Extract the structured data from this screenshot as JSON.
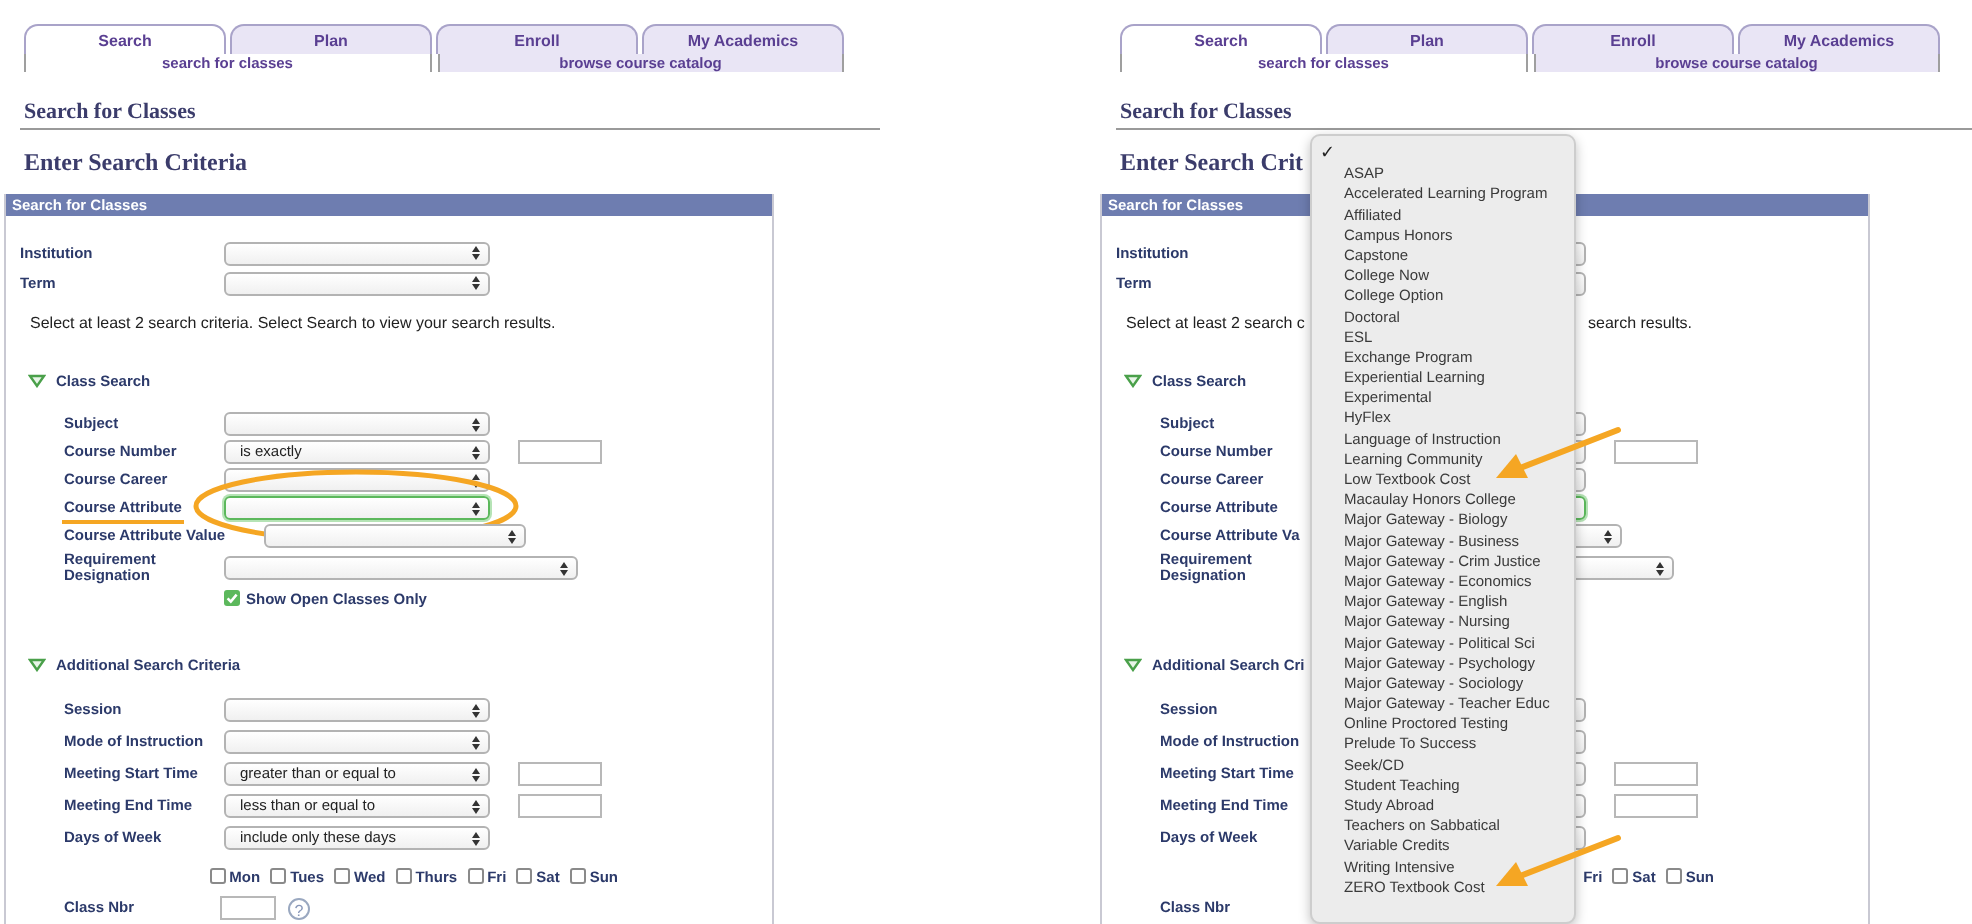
{
  "panels": [
    {
      "tabs": [
        {
          "label": "Search",
          "selected": true
        },
        {
          "label": "Plan",
          "selected": false
        },
        {
          "label": "Enroll",
          "selected": false
        },
        {
          "label": "My Academics",
          "selected": false
        }
      ],
      "subtabs": [
        {
          "label": "search for classes",
          "selected": true
        },
        {
          "label": "browse course catalog",
          "selected": false
        }
      ],
      "title": "Search for Classes",
      "subtitle": "Enter Search Criteria",
      "box_title": "Search for Classes",
      "top_fields": [
        {
          "label": "Institution",
          "kind": "select"
        },
        {
          "label": "Term",
          "kind": "select"
        }
      ],
      "note_parts": [
        "Select at least 2 search criteria. Select Search to view your search results."
      ],
      "sections": [
        {
          "title": "Class Search",
          "expanded": true,
          "fields": [
            {
              "label": "Subject",
              "kind": "select"
            },
            {
              "label": "Course Number",
              "kind": "select_input",
              "value": "is exactly"
            },
            {
              "label": "Course Career",
              "kind": "select"
            },
            {
              "label": "Course Attribute",
              "kind": "select",
              "focused": true,
              "circled": true,
              "underlined": true
            },
            {
              "label": "Course Attribute Value",
              "kind": "select_offset"
            },
            {
              "label": "Requirement Designation",
              "kind": "select_wide"
            },
            {
              "label": "Show Open Classes Only",
              "kind": "checkbox",
              "checked": true
            }
          ]
        },
        {
          "title": "Additional Search Criteria",
          "expanded": true,
          "fields": [
            {
              "label": "Session",
              "kind": "select"
            },
            {
              "label": "Mode of Instruction",
              "kind": "select"
            },
            {
              "label": "Meeting Start Time",
              "kind": "select_input",
              "value": "greater than or equal to"
            },
            {
              "label": "Meeting End Time",
              "kind": "select_input",
              "value": "less than or equal to"
            },
            {
              "label": "Days of Week",
              "kind": "select",
              "value": "include only these days"
            },
            {
              "kind": "days",
              "days": [
                {
                  "label": "Mon",
                  "checked": false
                },
                {
                  "label": "Tues",
                  "checked": false
                },
                {
                  "label": "Wed",
                  "checked": false
                },
                {
                  "label": "Thurs",
                  "checked": false
                },
                {
                  "label": "Fri",
                  "checked": false
                },
                {
                  "label": "Sat",
                  "checked": false
                },
                {
                  "label": "Sun",
                  "checked": false
                }
              ]
            },
            {
              "label": "Class Nbr",
              "kind": "input_help",
              "help": "?"
            }
          ]
        }
      ]
    },
    {
      "tabs": [
        {
          "label": "Search",
          "selected": true
        },
        {
          "label": "Plan",
          "selected": false
        },
        {
          "label": "Enroll",
          "selected": false
        },
        {
          "label": "My Academics",
          "selected": false
        }
      ],
      "subtabs": [
        {
          "label": "search for classes",
          "selected": true
        },
        {
          "label": "browse course catalog",
          "selected": false
        }
      ],
      "title": "Search for Classes",
      "subtitle": "Enter Search Crit",
      "box_title": "Search for Classes",
      "top_fields": [
        {
          "label": "Institution",
          "kind": "select"
        },
        {
          "label": "Term",
          "kind": "select"
        }
      ],
      "note_parts": [
        "Select at least 2 search c",
        "search results."
      ],
      "sections": [
        {
          "title": "Class Search",
          "expanded": true,
          "fields": [
            {
              "label": "Subject",
              "kind": "select"
            },
            {
              "label": "Course Number",
              "kind": "select_input"
            },
            {
              "label": "Course Career",
              "kind": "select"
            },
            {
              "label": "Course Attribute",
              "kind": "select",
              "focused": true
            },
            {
              "label": "Course Attribute Va",
              "kind": "select_offset"
            },
            {
              "label": "Requirement Designation",
              "kind": "select_wide"
            }
          ]
        },
        {
          "title": "Additional Search Cri",
          "expanded": true,
          "fields": [
            {
              "label": "Session",
              "kind": "select"
            },
            {
              "label": "Mode of Instruction",
              "kind": "select"
            },
            {
              "label": "Meeting Start Time",
              "kind": "select_input"
            },
            {
              "label": "Meeting End Time",
              "kind": "select_input"
            },
            {
              "label": "Days of Week",
              "kind": "select"
            },
            {
              "kind": "days",
              "days": [
                {
                  "label": "Fri"
                },
                {
                  "label": "Sat",
                  "checked": false
                },
                {
                  "label": "Sun",
                  "checked": false
                }
              ]
            },
            {
              "label": "Class Nbr",
              "kind": "label"
            }
          ]
        }
      ],
      "menu": {
        "checkmark": "✓",
        "options": [
          {
            "selected": true
          },
          {
            "label": "ASAP",
            "selected": false
          },
          {
            "label": "Accelerated Learning Program",
            "selected": false
          },
          {
            "label": "Affiliated",
            "selected": false
          },
          {
            "label": "Campus Honors",
            "selected": false
          },
          {
            "label": "Capstone",
            "selected": false
          },
          {
            "label": "College Now",
            "selected": false
          },
          {
            "label": "College Option",
            "selected": false
          },
          {
            "label": "Doctoral",
            "selected": false
          },
          {
            "label": "ESL",
            "selected": false
          },
          {
            "label": "Exchange Program",
            "selected": false
          },
          {
            "label": "Experiential Learning",
            "selected": false
          },
          {
            "label": "Experimental",
            "selected": false
          },
          {
            "label": "HyFlex",
            "selected": false
          },
          {
            "label": "Language of Instruction",
            "selected": false
          },
          {
            "label": "Learning Community",
            "selected": false
          },
          {
            "label": "Low Textbook Cost",
            "selected": false,
            "arrow": true
          },
          {
            "label": "Macaulay Honors College",
            "selected": false
          },
          {
            "label": "Major Gateway - Biology",
            "selected": false
          },
          {
            "label": "Major Gateway - Business",
            "selected": false
          },
          {
            "label": "Major Gateway - Crim Justice",
            "selected": false
          },
          {
            "label": "Major Gateway - Economics",
            "selected": false
          },
          {
            "label": "Major Gateway - English",
            "selected": false
          },
          {
            "label": "Major Gateway - Nursing",
            "selected": false
          },
          {
            "label": "Major Gateway - Political Sci",
            "selected": false
          },
          {
            "label": "Major Gateway - Psychology",
            "selected": false
          },
          {
            "label": "Major Gateway - Sociology",
            "selected": false
          },
          {
            "label": "Major Gateway - Teacher Educ",
            "selected": false
          },
          {
            "label": "Online Proctored Testing",
            "selected": false
          },
          {
            "label": "Prelude To Success",
            "selected": false
          },
          {
            "label": "Seek/CD",
            "selected": false
          },
          {
            "label": "Student Teaching",
            "selected": false
          },
          {
            "label": "Study Abroad",
            "selected": false
          },
          {
            "label": "Teachers on Sabbatical",
            "selected": false
          },
          {
            "label": "Variable Credits",
            "selected": false
          },
          {
            "label": "Writing Intensive",
            "selected": false
          },
          {
            "label": "ZERO Textbook Cost",
            "selected": false,
            "arrow": true
          }
        ]
      }
    }
  ]
}
